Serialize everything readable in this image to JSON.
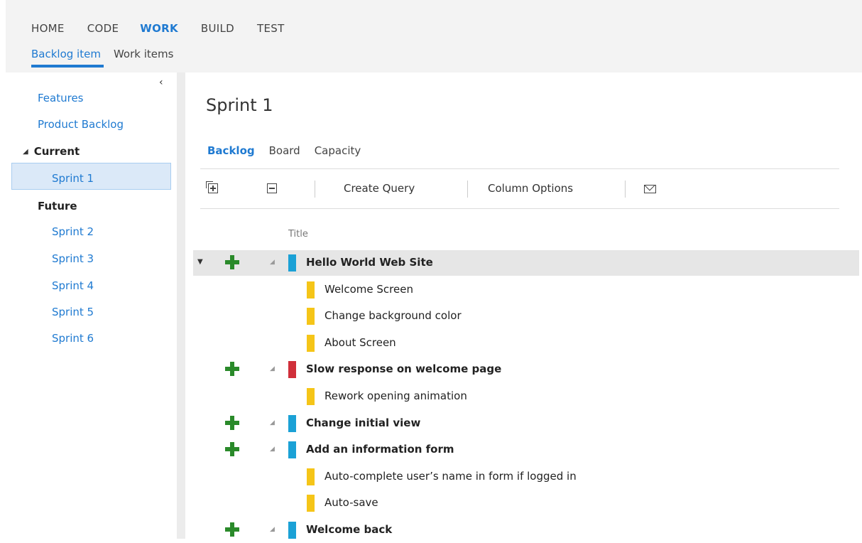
{
  "nav": {
    "main": [
      "HOME",
      "CODE",
      "WORK",
      "BUILD",
      "TEST"
    ],
    "active_main": "WORK",
    "sub": [
      "Backlog item",
      "Work items"
    ],
    "active_sub": "Backlog item"
  },
  "sidebar": {
    "collapse_glyph": "‹",
    "links": [
      "Features",
      "Product Backlog"
    ],
    "current_heading": "Current",
    "current_sprint": "Sprint 1",
    "future_heading": "Future",
    "future_sprints": [
      "Sprint 2",
      "Sprint 3",
      "Sprint 4",
      "Sprint 5",
      "Sprint 6"
    ]
  },
  "main": {
    "title": "Sprint 1",
    "tabs": [
      "Backlog",
      "Board",
      "Capacity"
    ],
    "active_tab": "Backlog",
    "toolbar": {
      "expand_icon": "expand-all-icon",
      "collapse_icon": "collapse-all-icon",
      "create_query": "Create Query",
      "column_options": "Column Options",
      "mail_icon": "mail-icon"
    },
    "column_title": "Title"
  },
  "colors": {
    "accent": "#1f7ad1",
    "pbi": "#1ba1d6",
    "bug": "#d02f3a",
    "task": "#f5c518",
    "add": "#2a8a2a"
  },
  "backlog": [
    {
      "title": "Hello World Web Site",
      "type": "pbi",
      "parent": true,
      "selected": true
    },
    {
      "title": "Welcome Screen",
      "type": "task",
      "parent": false
    },
    {
      "title": "Change background color",
      "type": "task",
      "parent": false
    },
    {
      "title": "About Screen",
      "type": "task",
      "parent": false
    },
    {
      "title": "Slow response on welcome page",
      "type": "bug",
      "parent": true
    },
    {
      "title": "Rework opening animation",
      "type": "task",
      "parent": false
    },
    {
      "title": "Change initial view",
      "type": "pbi",
      "parent": true
    },
    {
      "title": "Add an information form",
      "type": "pbi",
      "parent": true
    },
    {
      "title": "Auto-complete user’s name in form if logged in",
      "type": "task",
      "parent": false
    },
    {
      "title": "Auto-save",
      "type": "task",
      "parent": false
    },
    {
      "title": "Welcome back",
      "type": "pbi",
      "parent": true
    }
  ]
}
